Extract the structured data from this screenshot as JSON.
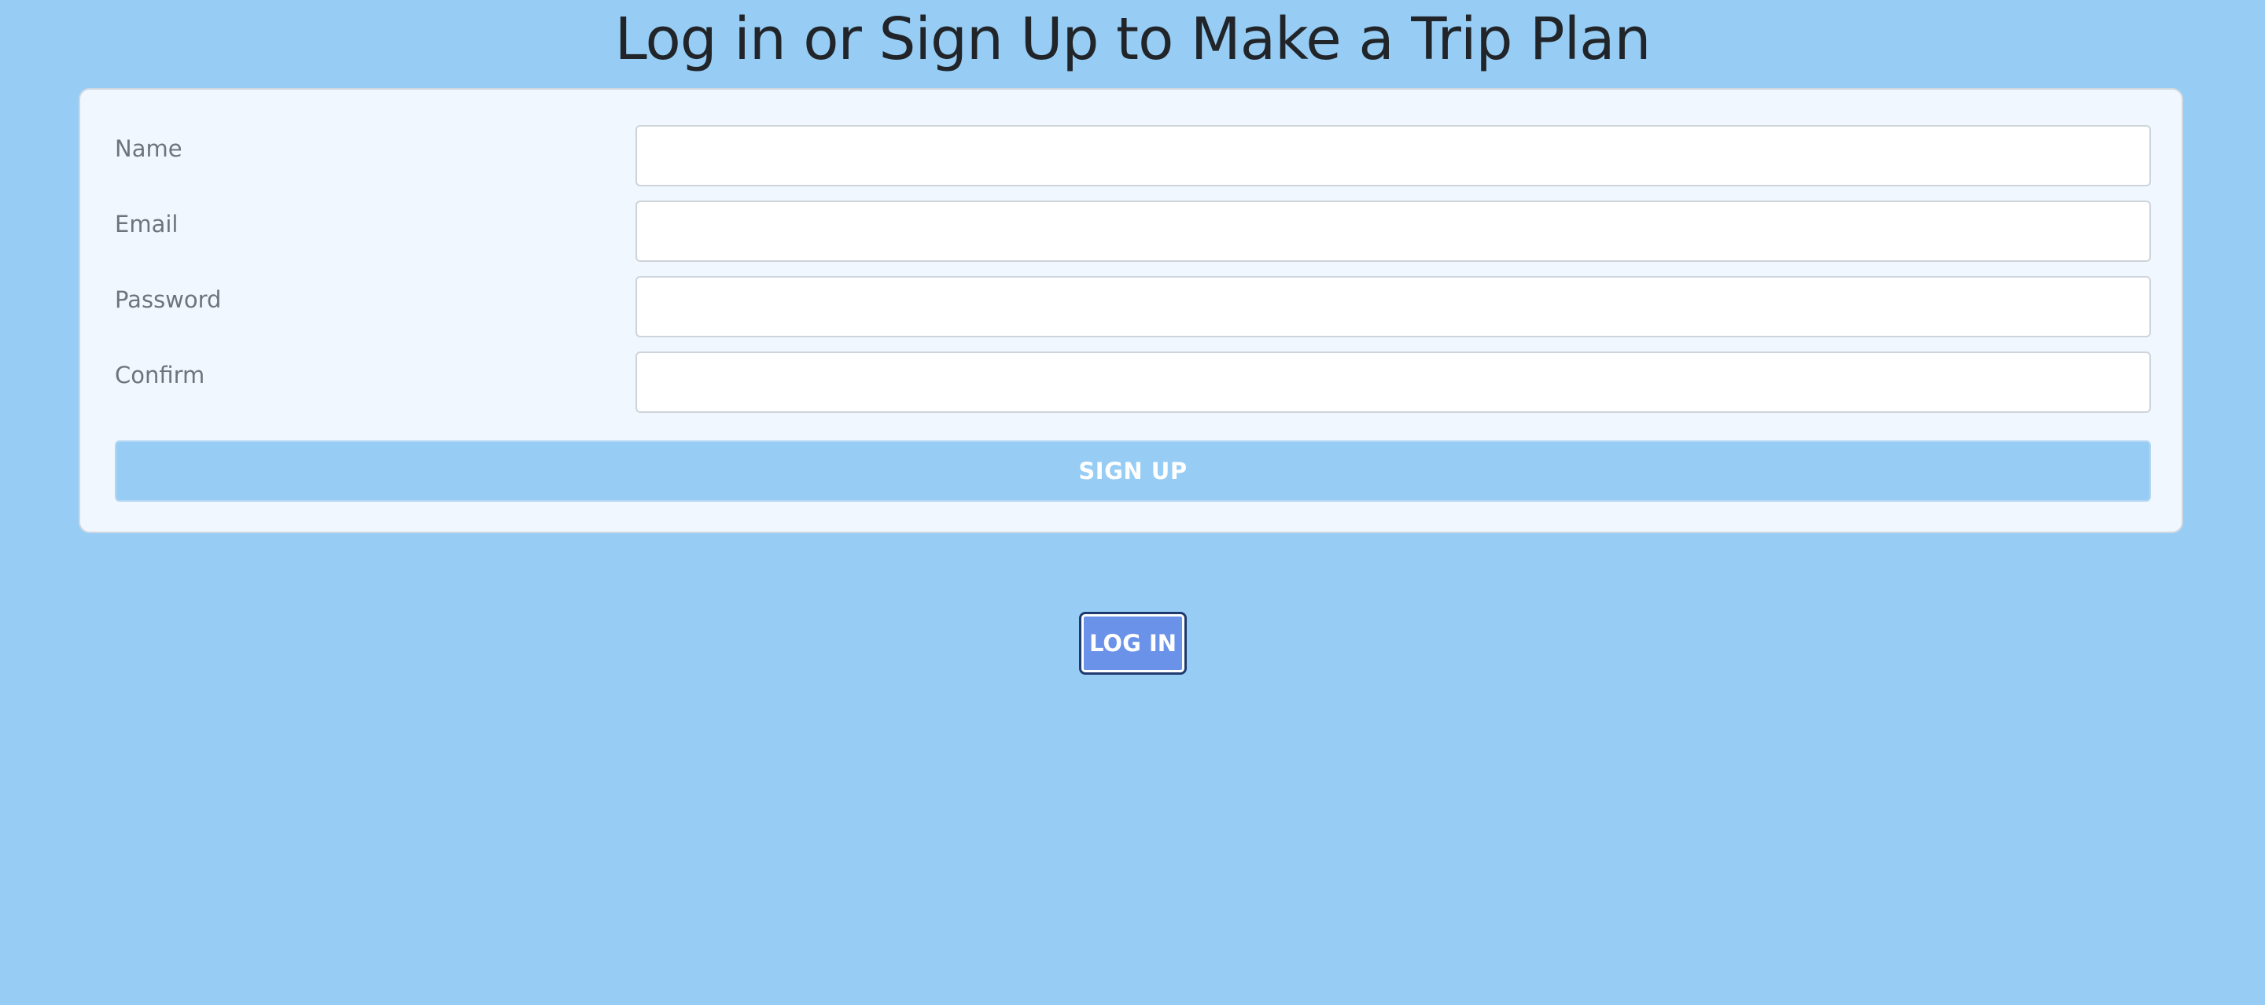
{
  "page": {
    "title": "Log in or Sign Up to Make a Trip Plan"
  },
  "signup_form": {
    "fields": [
      {
        "label": "Name",
        "value": "",
        "placeholder": ""
      },
      {
        "label": "Email",
        "value": "",
        "placeholder": ""
      },
      {
        "label": "Password",
        "value": "",
        "placeholder": ""
      },
      {
        "label": "Confirm",
        "value": "",
        "placeholder": ""
      }
    ],
    "submit_label": "SIGN UP"
  },
  "login": {
    "label": "LOG IN"
  },
  "colors": {
    "page_background": "#97cdf5",
    "card_background": "#f0f7fe",
    "signup_button": "#97cdf5",
    "login_button": "#6a92e8",
    "title_text": "#212529",
    "label_text": "#6c757d"
  }
}
